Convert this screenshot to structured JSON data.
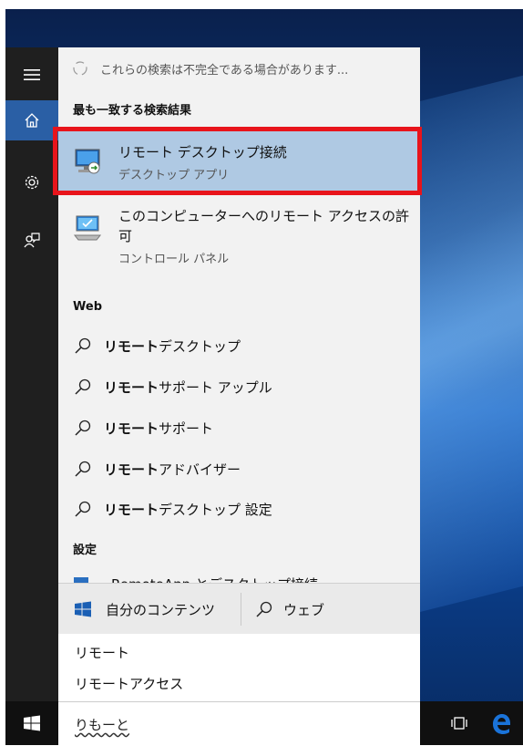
{
  "notice": {
    "text": "これらの検索は不完全である場合があります..."
  },
  "best_match": {
    "header": "最も一致する検索結果",
    "title": "リモート デスクトップ接続",
    "subtitle": "デスクトップ アプリ"
  },
  "result2": {
    "title_line1": "このコンピューターへのリモート アクセスの許",
    "title_line2": "可",
    "subtitle": "コントロール パネル"
  },
  "web": {
    "header": "Web",
    "items": [
      {
        "bold": "リモート",
        "rest": "デスクトップ"
      },
      {
        "bold": "リモート",
        "rest": "サポート アップル"
      },
      {
        "bold": "リモート",
        "rest": "サポート"
      },
      {
        "bold": "リモート",
        "rest": "アドバイザー"
      },
      {
        "bold": "リモート",
        "rest": "デスクトップ 設定"
      }
    ]
  },
  "settings": {
    "header": "設定",
    "partial_item": "RemoteApp とデスクトップ接続"
  },
  "bottom": {
    "my_content": "自分のコンテンツ",
    "web": "ウェブ"
  },
  "suggestions": [
    "リモート",
    "リモートアクセス"
  ],
  "search": {
    "value": "りもーと"
  },
  "colors": {
    "highlight_border": "#e8141b",
    "selected_bg": "#afc9e3",
    "edge_blue": "#1a73d9"
  },
  "icons": {
    "rail": [
      "hamburger-icon",
      "home-icon",
      "gear-icon",
      "feedback-icon"
    ],
    "taskbar": [
      "windows-logo-icon",
      "task-view-icon",
      "edge-icon"
    ]
  }
}
